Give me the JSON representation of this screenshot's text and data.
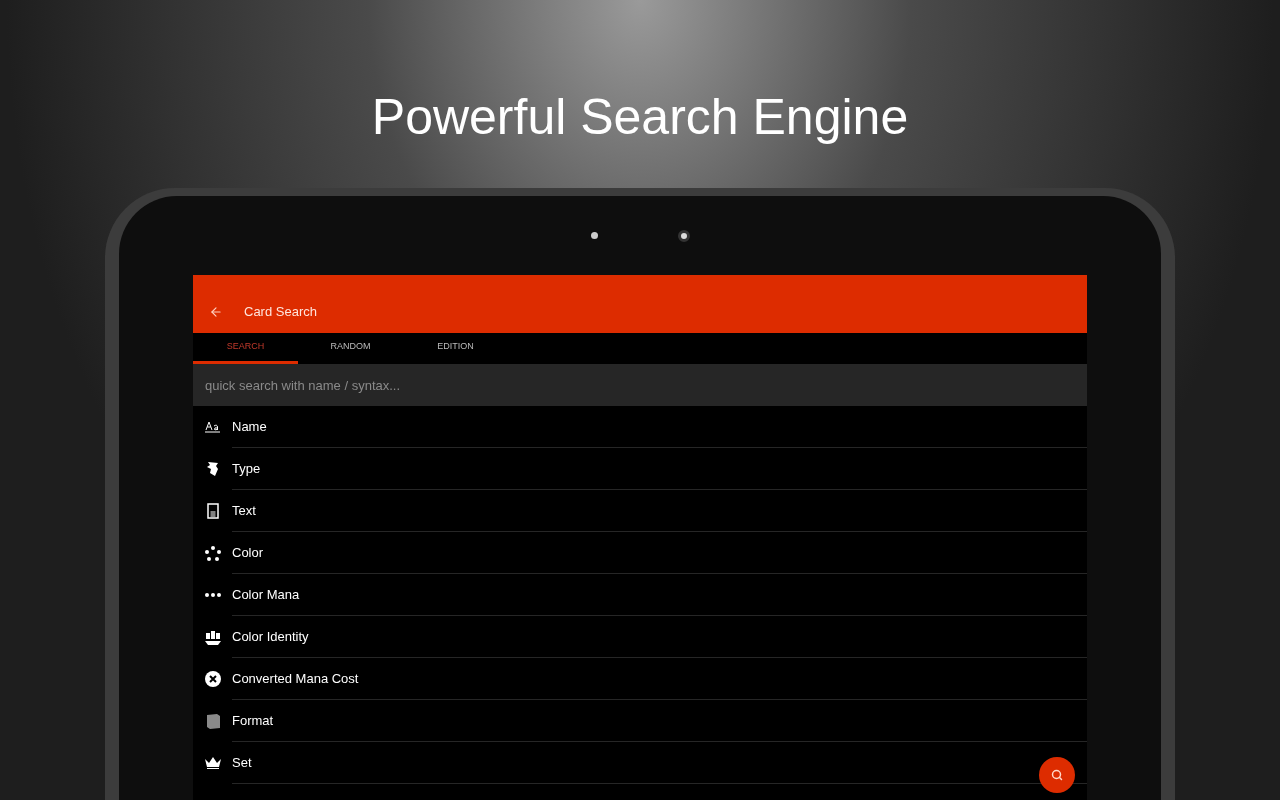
{
  "headline": "Powerful Search Engine",
  "app_bar": {
    "title": "Card Search"
  },
  "tabs": [
    {
      "label": "SEARCH",
      "selected": true
    },
    {
      "label": "RANDOM",
      "selected": false
    },
    {
      "label": "EDITION",
      "selected": false
    }
  ],
  "search": {
    "placeholder": "quick search with name / syntax..."
  },
  "items": [
    {
      "label": "Name"
    },
    {
      "label": "Type"
    },
    {
      "label": "Text"
    },
    {
      "label": "Color"
    },
    {
      "label": "Color Mana"
    },
    {
      "label": "Color Identity"
    },
    {
      "label": "Converted Mana Cost"
    },
    {
      "label": "Format"
    },
    {
      "label": "Set"
    }
  ]
}
